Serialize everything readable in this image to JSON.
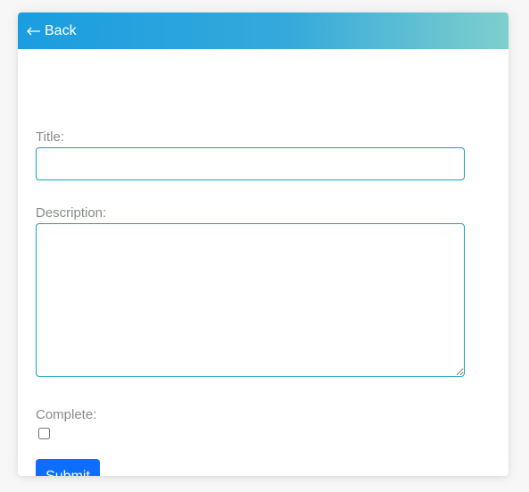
{
  "header": {
    "back_label": "Back",
    "back_icon": "left-arrow-icon",
    "gradient_start": "#1a9de0",
    "gradient_end": "#7ecfcc"
  },
  "form": {
    "title_label": "Title:",
    "title_value": "",
    "description_label": "Description:",
    "description_value": "",
    "complete_label": "Complete:",
    "complete_checked": false,
    "submit_label": "Submit",
    "input_border_color": "#17a2b8",
    "submit_color": "#0d6efd"
  }
}
